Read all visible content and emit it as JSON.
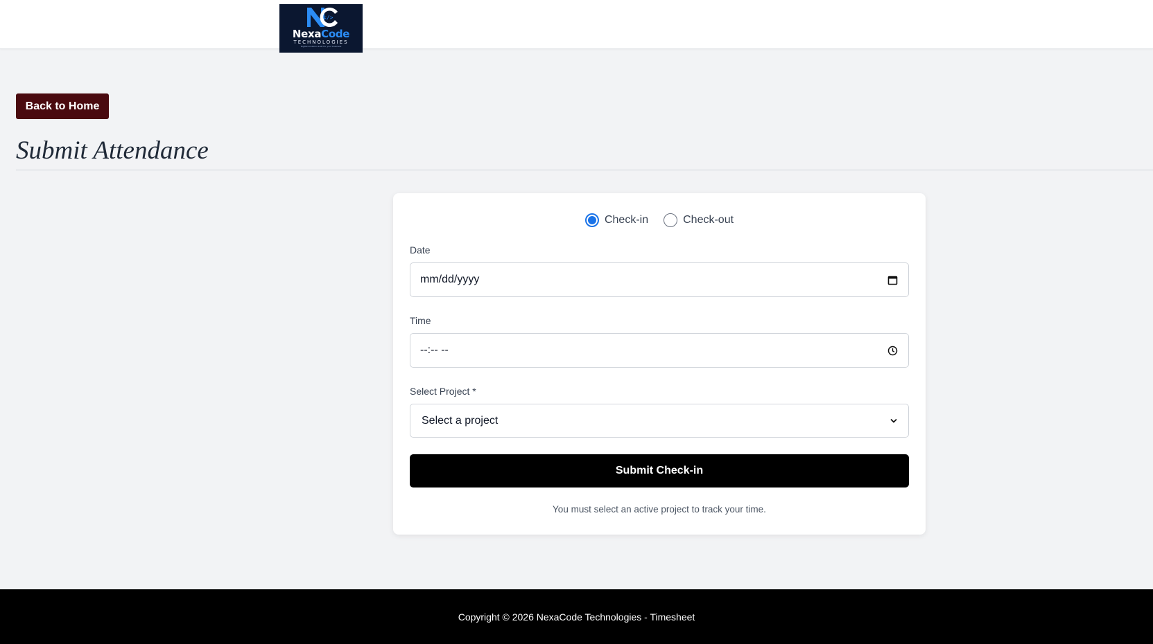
{
  "header": {
    "logo": {
      "brand_part1": "Nexa",
      "brand_part2": "Code",
      "subtitle": "TECHNOLOGIES",
      "tagline": "Digital solutions built for your business",
      "colors": {
        "background": "#0b1730",
        "accent": "#2b8cf5",
        "text": "#ffffff"
      }
    }
  },
  "nav": {
    "back_label": "Back to Home"
  },
  "page": {
    "title": "Submit Attendance"
  },
  "form": {
    "mode_options": [
      {
        "label": "Check-in",
        "selected": true
      },
      {
        "label": "Check-out",
        "selected": false
      }
    ],
    "date": {
      "label": "Date",
      "placeholder": "mm/dd/yyyy",
      "icon": "calendar-icon"
    },
    "time": {
      "label": "Time",
      "placeholder": "--:-- --",
      "icon": "clock-icon"
    },
    "project": {
      "label": "Select Project *",
      "selected_value": "Select a project",
      "icon": "chevron-down-icon"
    },
    "submit_label": "Submit Check-in",
    "hint": "You must select an active project to track your time."
  },
  "footer": {
    "text": "Copyright © 2026 NexaCode Technologies - Timesheet"
  },
  "colors": {
    "back_button": "#4a0a0f",
    "submit_button": "#000000",
    "radio_accent": "#1a73e8",
    "page_background": "#f2f3f5",
    "footer_background": "#000000"
  }
}
